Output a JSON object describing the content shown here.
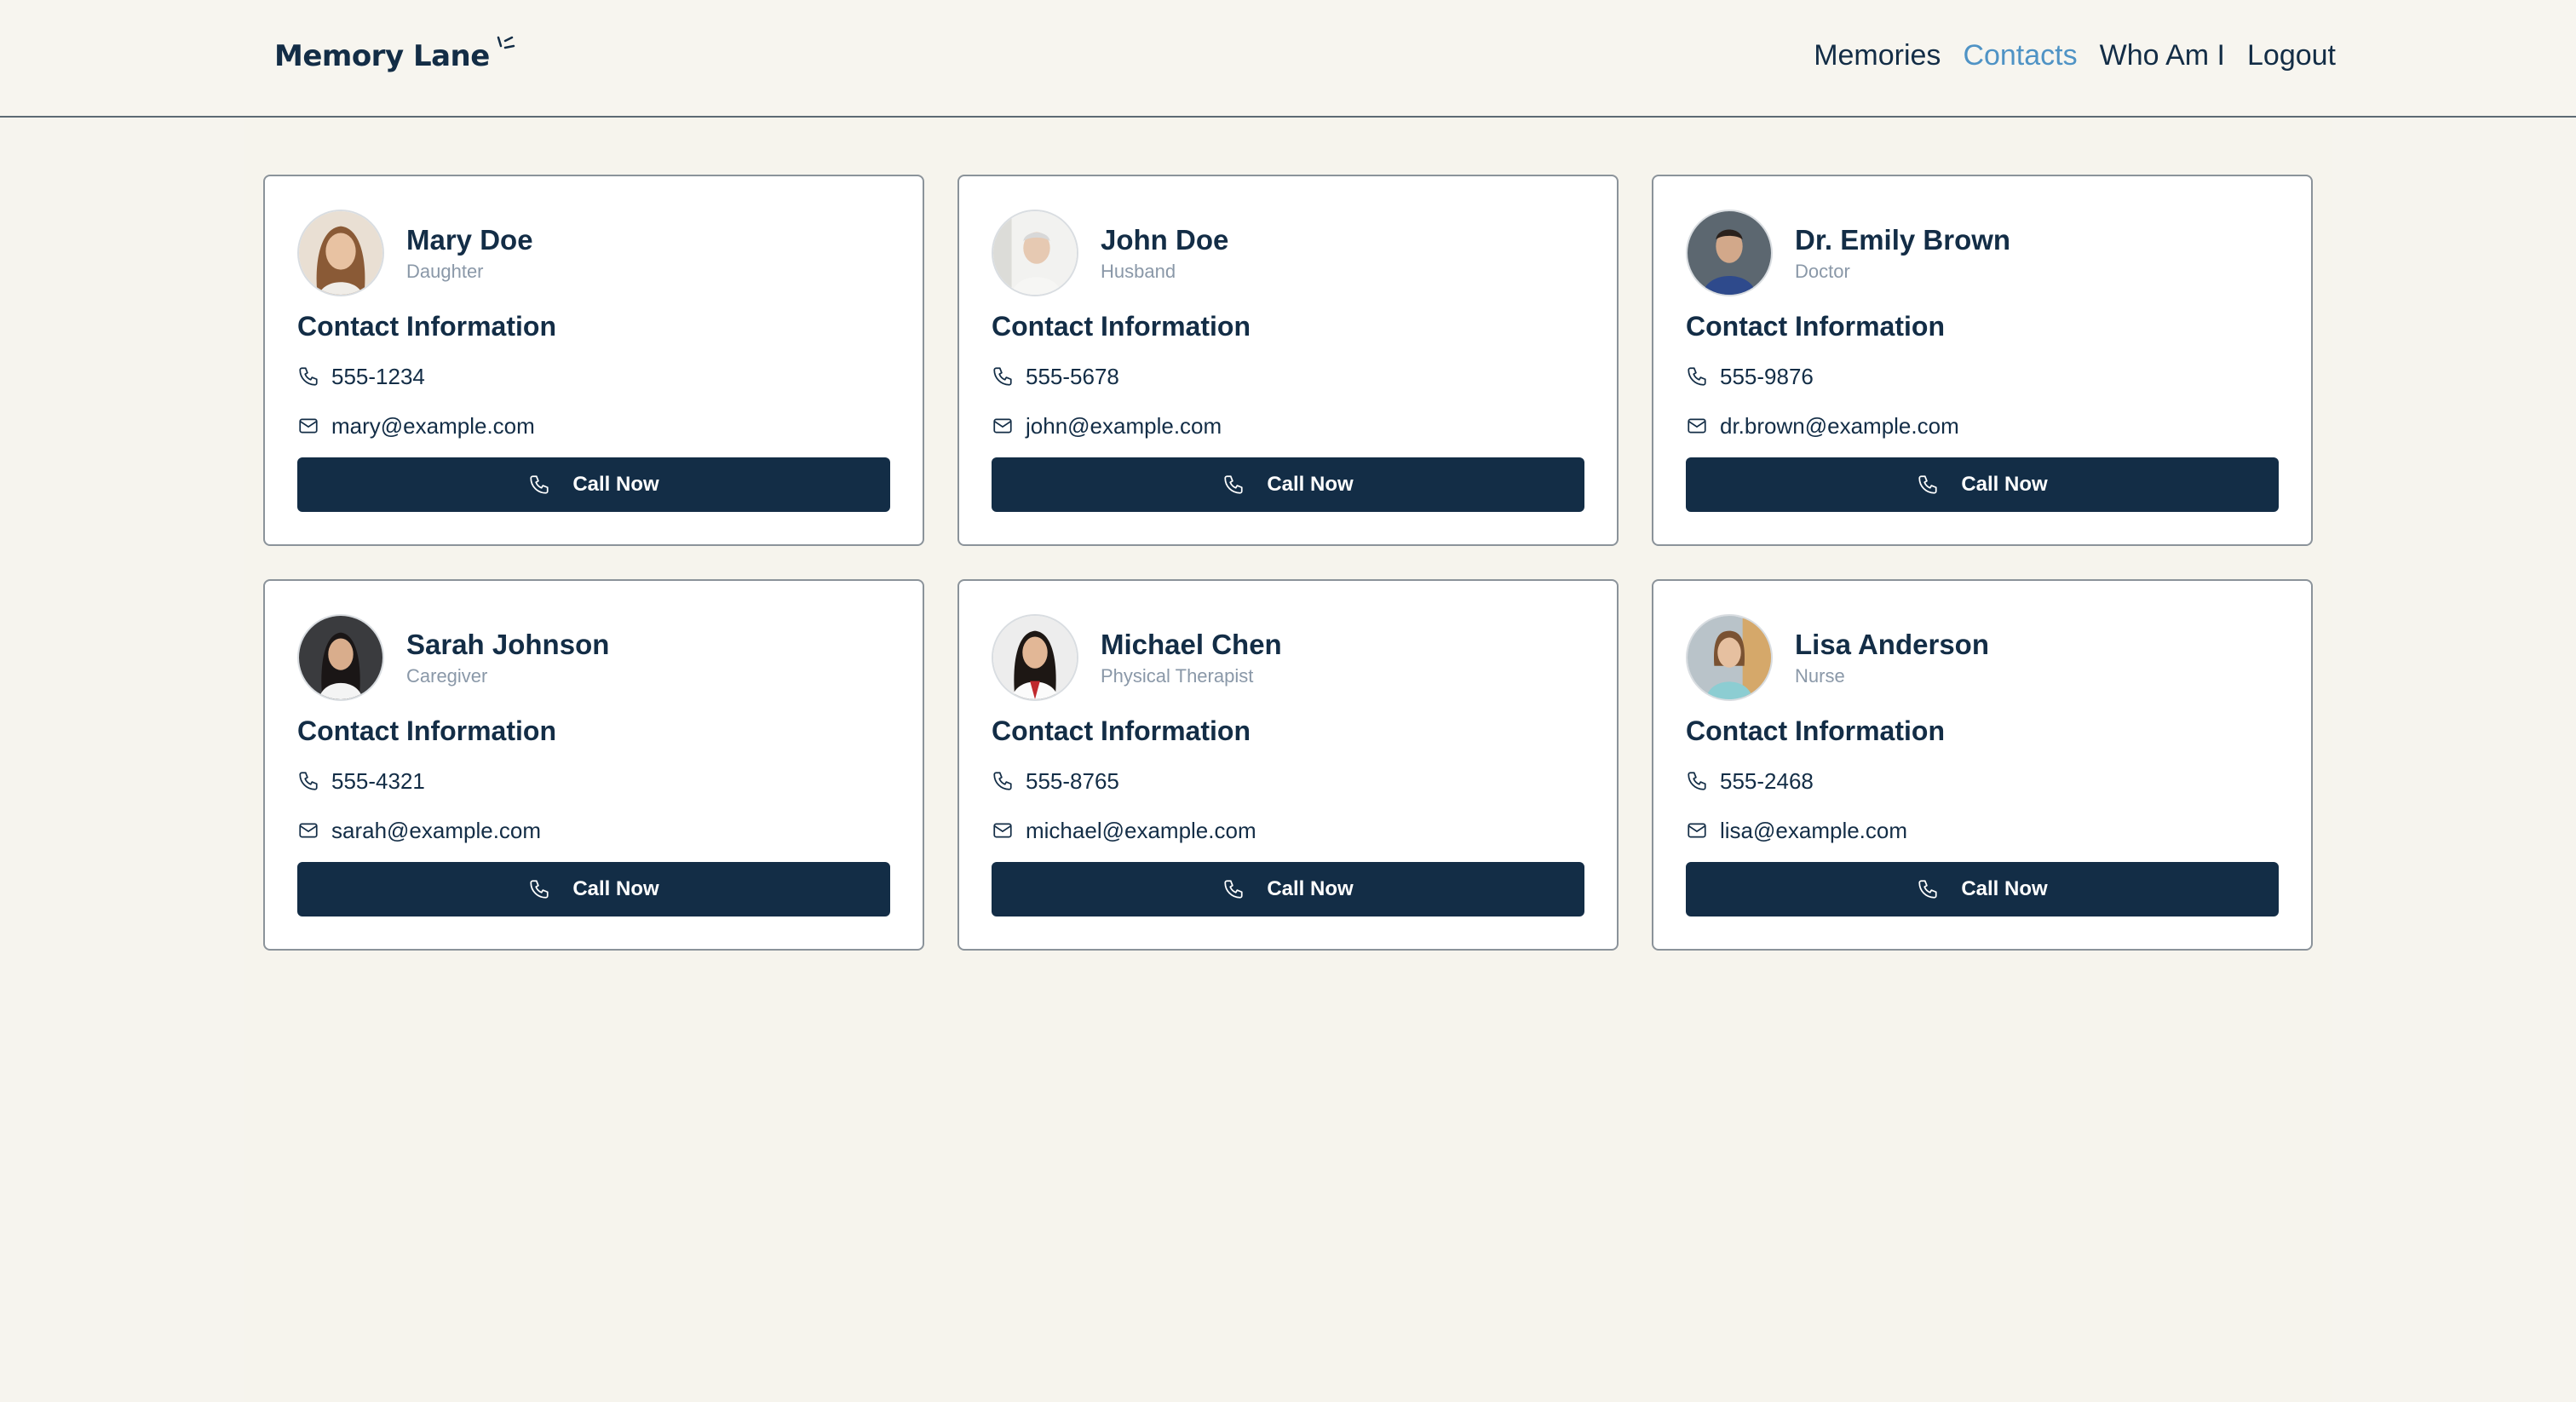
{
  "app": {
    "logo": "Memory Lane"
  },
  "nav": [
    {
      "label": "Memories",
      "active": false
    },
    {
      "label": "Contacts",
      "active": true
    },
    {
      "label": "Who Am I",
      "active": false
    },
    {
      "label": "Logout",
      "active": false
    }
  ],
  "colors": {
    "accent": "#132d46",
    "nav_active": "#4f93c5",
    "background": "#f6f4ee"
  },
  "section_label": "Contact Information",
  "button_label": "Call Now",
  "contacts": [
    {
      "name": "Mary Doe",
      "role": "Daughter",
      "phone": "555-1234",
      "email": "mary@example.com"
    },
    {
      "name": "John Doe",
      "role": "Husband",
      "phone": "555-5678",
      "email": "john@example.com"
    },
    {
      "name": "Dr. Emily Brown",
      "role": "Doctor",
      "phone": "555-9876",
      "email": "dr.brown@example.com"
    },
    {
      "name": "Sarah Johnson",
      "role": "Caregiver",
      "phone": "555-4321",
      "email": "sarah@example.com"
    },
    {
      "name": "Michael Chen",
      "role": "Physical Therapist",
      "phone": "555-8765",
      "email": "michael@example.com"
    },
    {
      "name": "Lisa Anderson",
      "role": "Nurse",
      "phone": "555-2468",
      "email": "lisa@example.com"
    }
  ]
}
